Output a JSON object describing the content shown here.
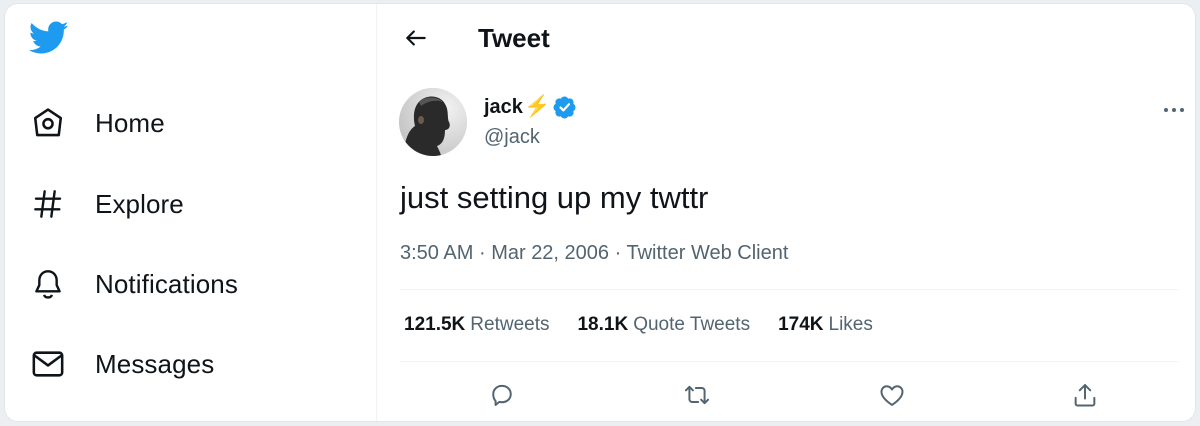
{
  "sidebar": {
    "logo_icon": "twitter-bird-icon",
    "brand_color": "#1d9bf0",
    "items": [
      {
        "label": "Home",
        "icon": "home-icon"
      },
      {
        "label": "Explore",
        "icon": "hashtag-icon"
      },
      {
        "label": "Notifications",
        "icon": "bell-icon"
      },
      {
        "label": "Messages",
        "icon": "envelope-icon"
      }
    ]
  },
  "header": {
    "back_icon": "arrow-left-icon",
    "title": "Tweet"
  },
  "tweet": {
    "author": {
      "name": "jack",
      "name_emoji": "⚡",
      "verified_icon": "verified-badge-icon",
      "handle": "@jack"
    },
    "more_icon": "more-horizontal-icon",
    "text": "just setting up my twttr",
    "meta": {
      "time": "3:50 AM",
      "separator": "·",
      "date": "Mar 22, 2006",
      "client": "Twitter Web Client"
    },
    "stats": [
      {
        "value": "121.5K",
        "label": "Retweets"
      },
      {
        "value": "18.1K",
        "label": "Quote Tweets"
      },
      {
        "value": "174K",
        "label": "Likes"
      }
    ],
    "actions": [
      "reply-icon",
      "retweet-icon",
      "like-icon",
      "share-icon"
    ]
  },
  "colors": {
    "accent": "#1d9bf0",
    "text_primary": "#0f1419",
    "text_secondary": "#536471",
    "border": "#eff3f4"
  }
}
